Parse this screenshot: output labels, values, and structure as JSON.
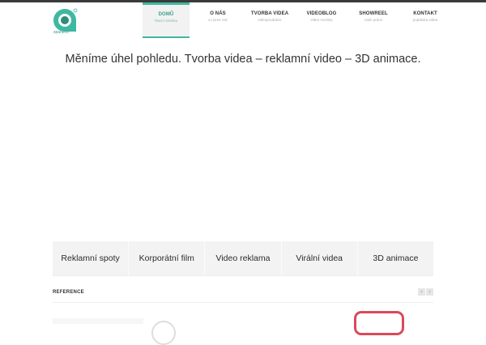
{
  "brand": {
    "logo_text": "spaneco"
  },
  "nav": [
    {
      "title": "DOMŮ",
      "sub": "hlavní stránka"
    },
    {
      "title": "O NÁS",
      "sub": "co jsme zač"
    },
    {
      "title": "TVORBA VIDEA",
      "sub": "videoprodukce"
    },
    {
      "title": "VIDEOBLOG",
      "sub": "video novinky"
    },
    {
      "title": "SHOWREEL",
      "sub": "naše práce"
    },
    {
      "title": "KONTAKT",
      "sub": "poptávka videa"
    }
  ],
  "tagline": "Měníme úhel pohledu. Tvorba videa – reklamní video – 3D animace.",
  "categories": [
    "Reklamní spoty",
    "Korporátní film",
    "Video reklama",
    "Virální videa",
    "3D animace"
  ],
  "reference": {
    "title": "REFERENCE",
    "prev": "‹",
    "next": "›"
  },
  "colors": {
    "accent": "#3fb8a1",
    "logo": "#3a9c8a",
    "topbar": "#3a3a3a",
    "strip": "#f3f3f3"
  }
}
